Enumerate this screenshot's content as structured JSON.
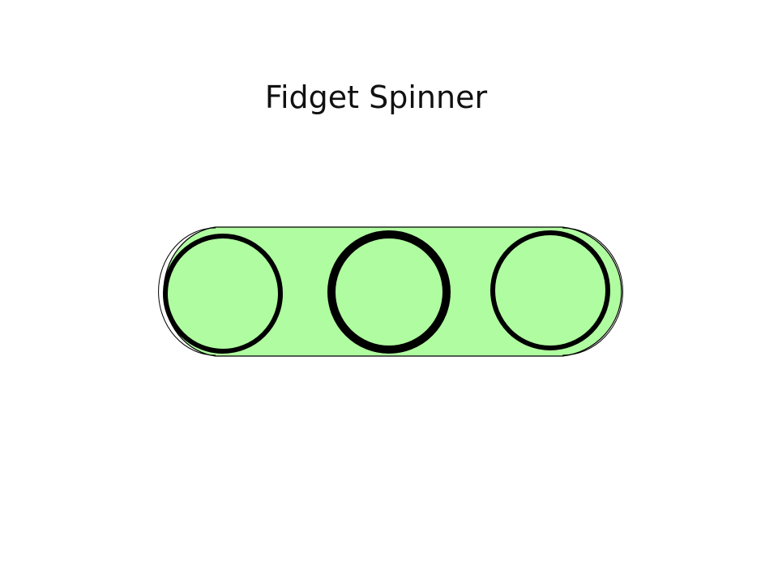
{
  "page": {
    "title": "Fidget Spinner"
  },
  "colors": {
    "body_fill": "#b0fca0",
    "outline": "#000000",
    "background": "#ffffff"
  }
}
